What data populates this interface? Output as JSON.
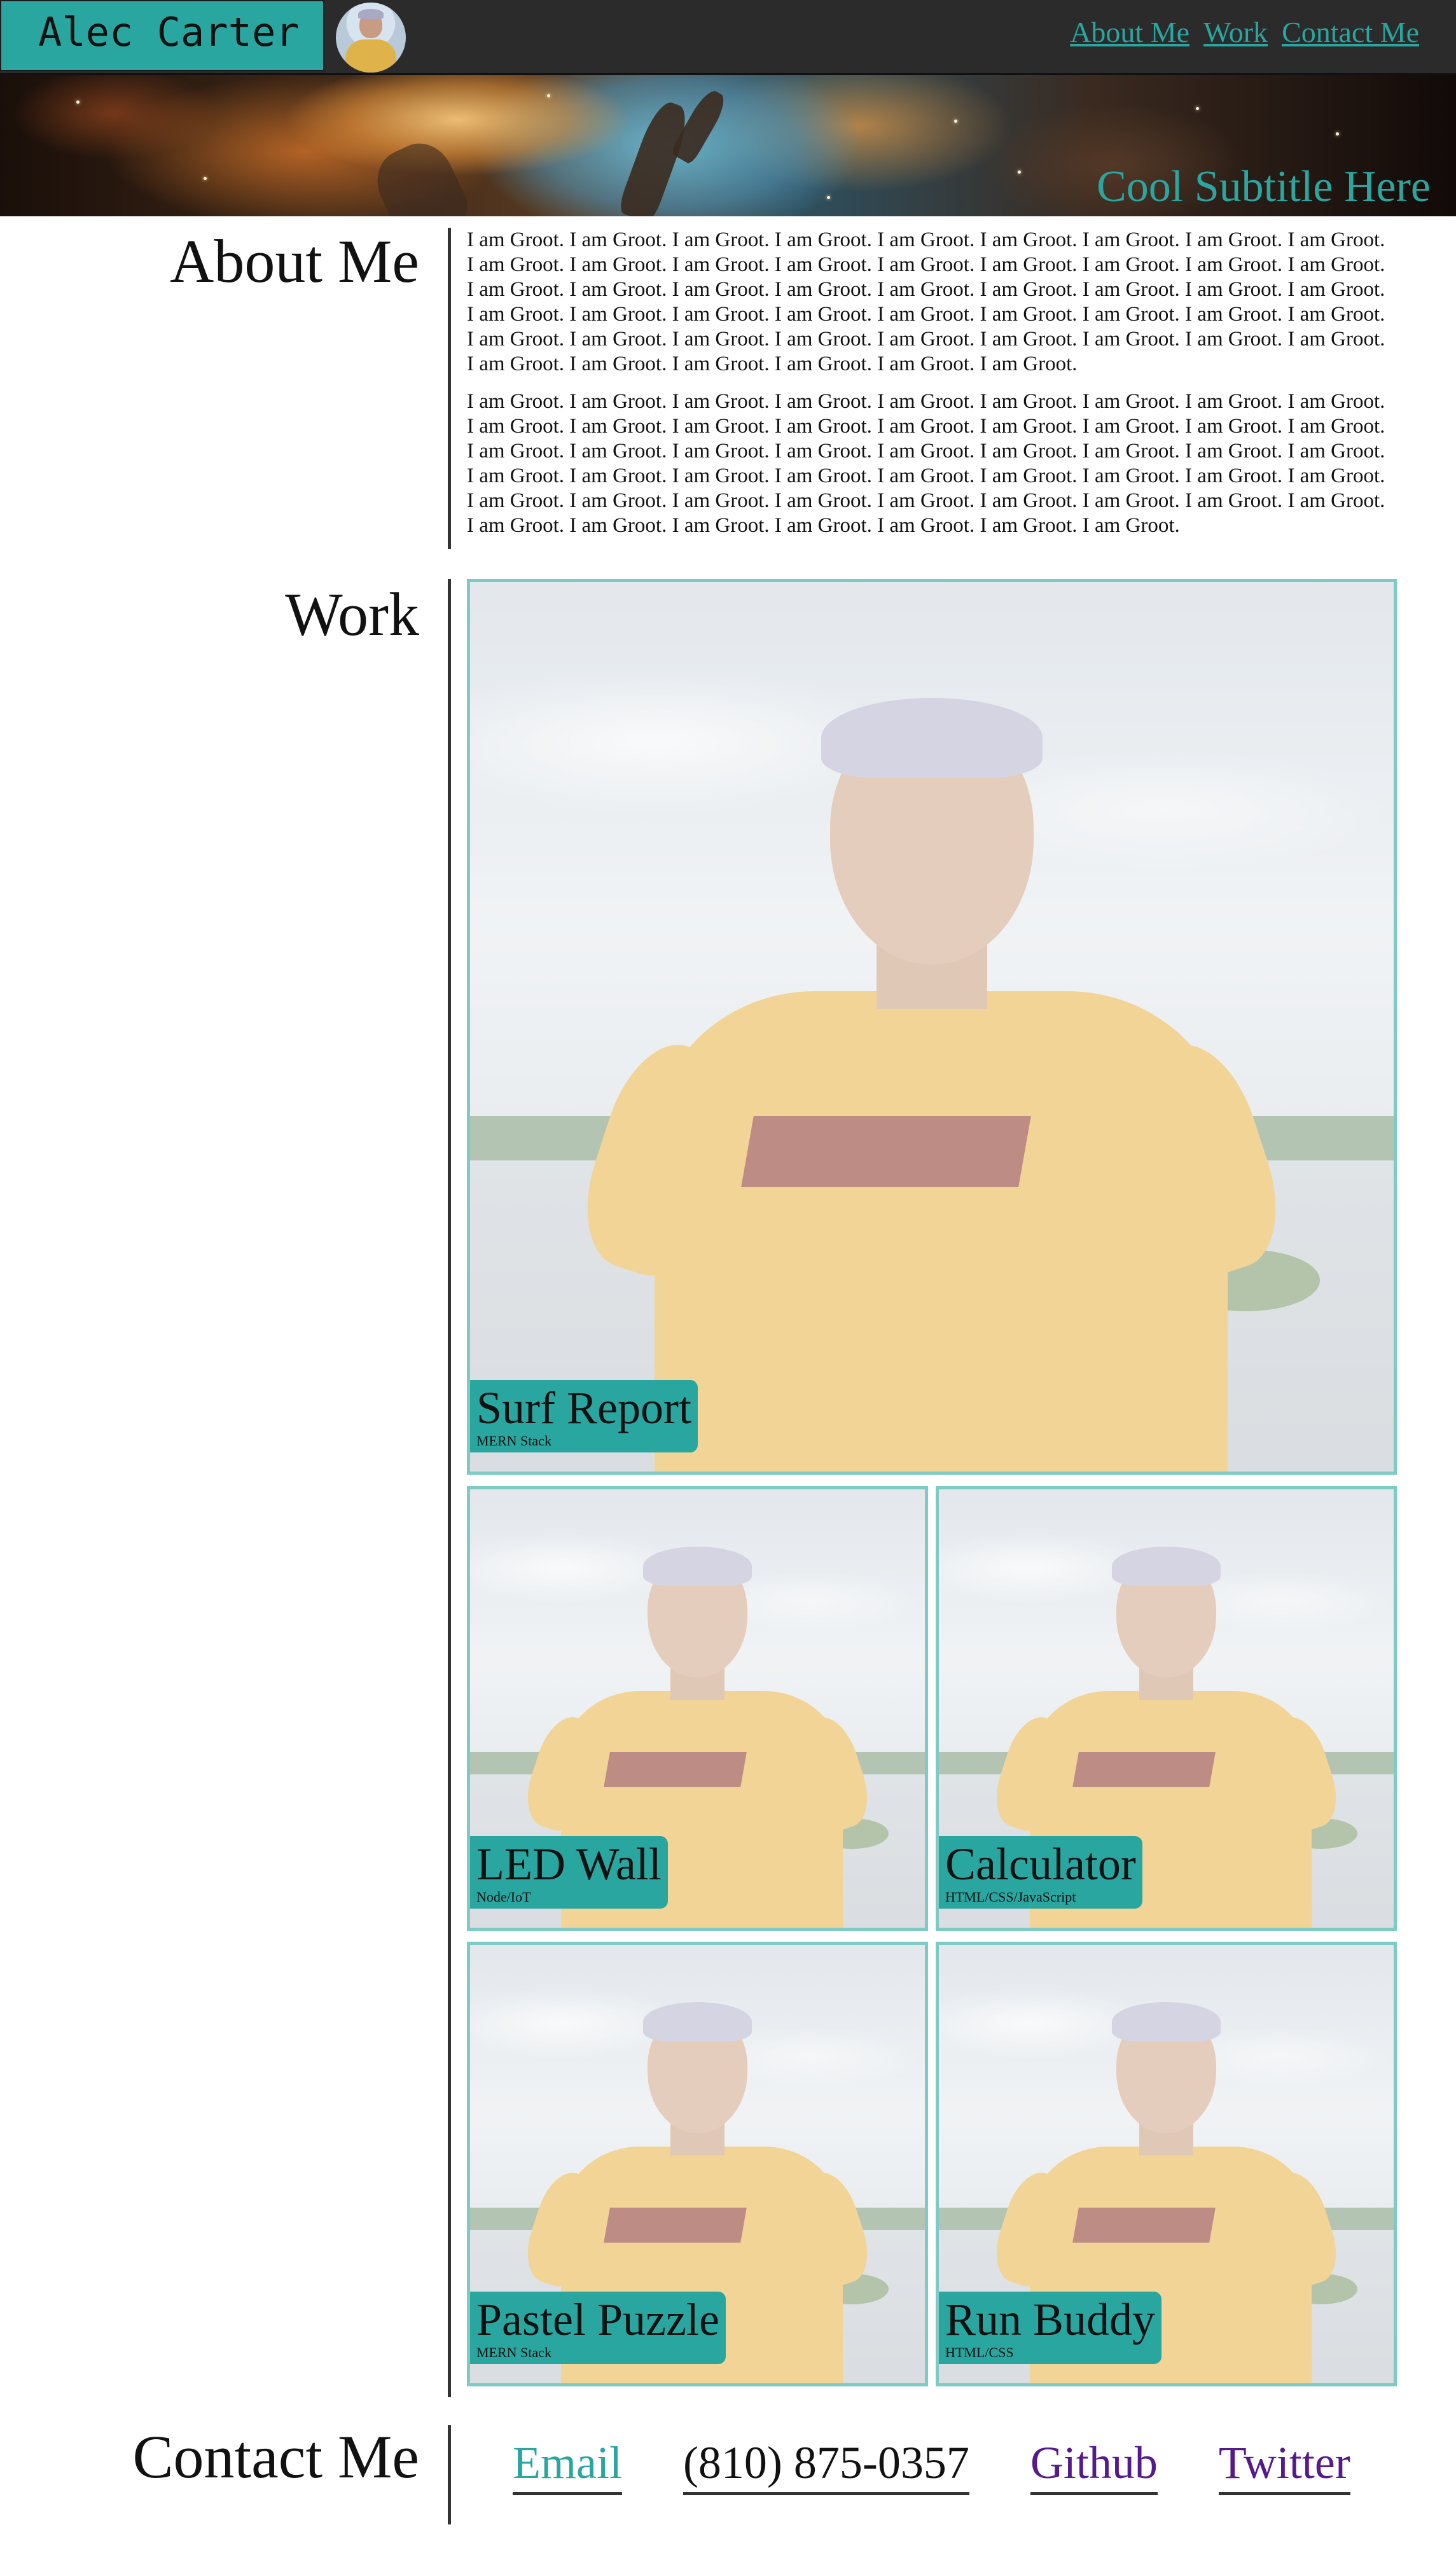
{
  "header": {
    "brand": "Alec Carter",
    "nav": [
      "About Me",
      "Work",
      "Contact Me"
    ]
  },
  "banner": {
    "subtitle": "Cool Subtitle Here"
  },
  "about": {
    "title": "About Me",
    "paragraphs": [
      "I am Groot. I am Groot. I am Groot. I am Groot. I am Groot. I am Groot. I am Groot. I am Groot. I am Groot. I am Groot. I am Groot. I am Groot. I am Groot. I am Groot. I am Groot. I am Groot. I am Groot. I am Groot. I am Groot. I am Groot. I am Groot. I am Groot. I am Groot. I am Groot. I am Groot. I am Groot. I am Groot. I am Groot. I am Groot. I am Groot. I am Groot. I am Groot. I am Groot. I am Groot. I am Groot. I am Groot. I am Groot. I am Groot. I am Groot. I am Groot. I am Groot. I am Groot. I am Groot. I am Groot. I am Groot. I am Groot. I am Groot. I am Groot. I am Groot. I am Groot. I am Groot.",
      "I am Groot. I am Groot. I am Groot. I am Groot. I am Groot. I am Groot. I am Groot. I am Groot. I am Groot. I am Groot. I am Groot. I am Groot. I am Groot. I am Groot. I am Groot. I am Groot. I am Groot. I am Groot. I am Groot. I am Groot. I am Groot. I am Groot. I am Groot. I am Groot. I am Groot. I am Groot. I am Groot. I am Groot. I am Groot. I am Groot. I am Groot. I am Groot. I am Groot. I am Groot. I am Groot. I am Groot. I am Groot. I am Groot. I am Groot. I am Groot. I am Groot. I am Groot. I am Groot. I am Groot. I am Groot. I am Groot. I am Groot. I am Groot. I am Groot. I am Groot. I am Groot. I am Groot."
    ]
  },
  "work": {
    "title": "Work",
    "projects": [
      {
        "title": "Surf Report",
        "stack": "MERN Stack"
      },
      {
        "title": "LED Wall",
        "stack": "Node/IoT"
      },
      {
        "title": "Calculator",
        "stack": "HTML/CSS/JavaScript"
      },
      {
        "title": "Pastel Puzzle",
        "stack": "MERN Stack"
      },
      {
        "title": "Run Buddy",
        "stack": "HTML/CSS"
      }
    ]
  },
  "contact": {
    "title": "Contact Me",
    "links": [
      "Email",
      "(810) 875-0357",
      "Github",
      "Twitter"
    ]
  },
  "colors": {
    "accent": "#2aa6a0",
    "header_bg": "#2b2b2b",
    "card_border": "#7ecbc6",
    "visited_link": "#551a8b"
  }
}
